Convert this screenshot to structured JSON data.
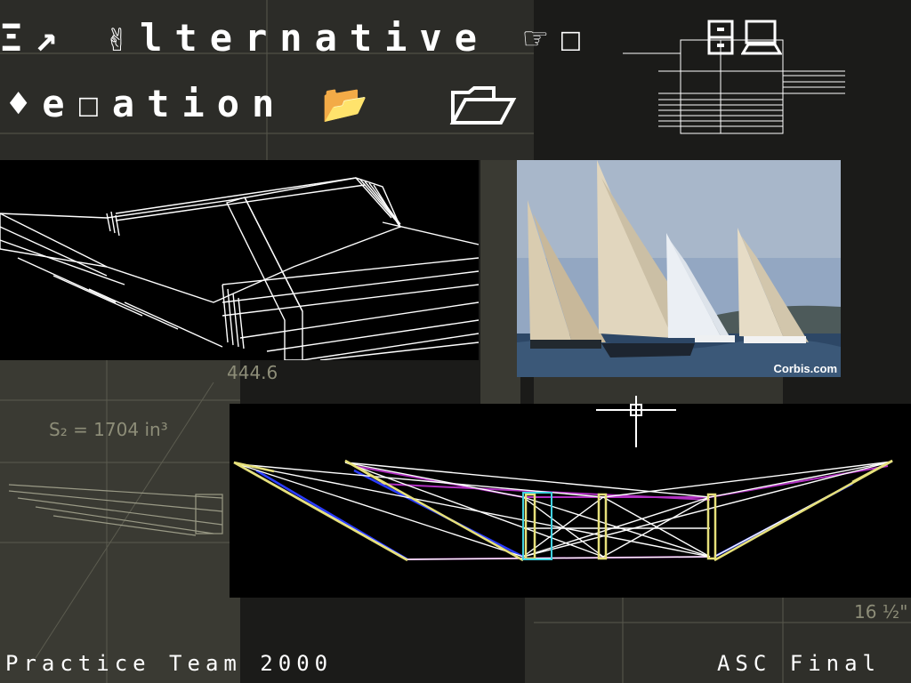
{
  "title": {
    "line1": "Ξ↗ ✌lternative ☞☐",
    "line2": "♦e☐ation 📂"
  },
  "photo": {
    "credit": "Corbis.com"
  },
  "footer": {
    "left": "Practice Team 2000",
    "right": "ASC Final"
  },
  "icons": [
    "file-cabinet-icon",
    "computer-icon",
    "folder-icon",
    "crosshair-cursor-icon"
  ],
  "colors": {
    "background": "#1a1a18",
    "drawing_lines": "#ffffff",
    "truss_yellow": "#e6e07a",
    "truss_purple": "#b030c0",
    "truss_blue": "#2a3cff",
    "truss_cyan": "#40d0e0"
  }
}
